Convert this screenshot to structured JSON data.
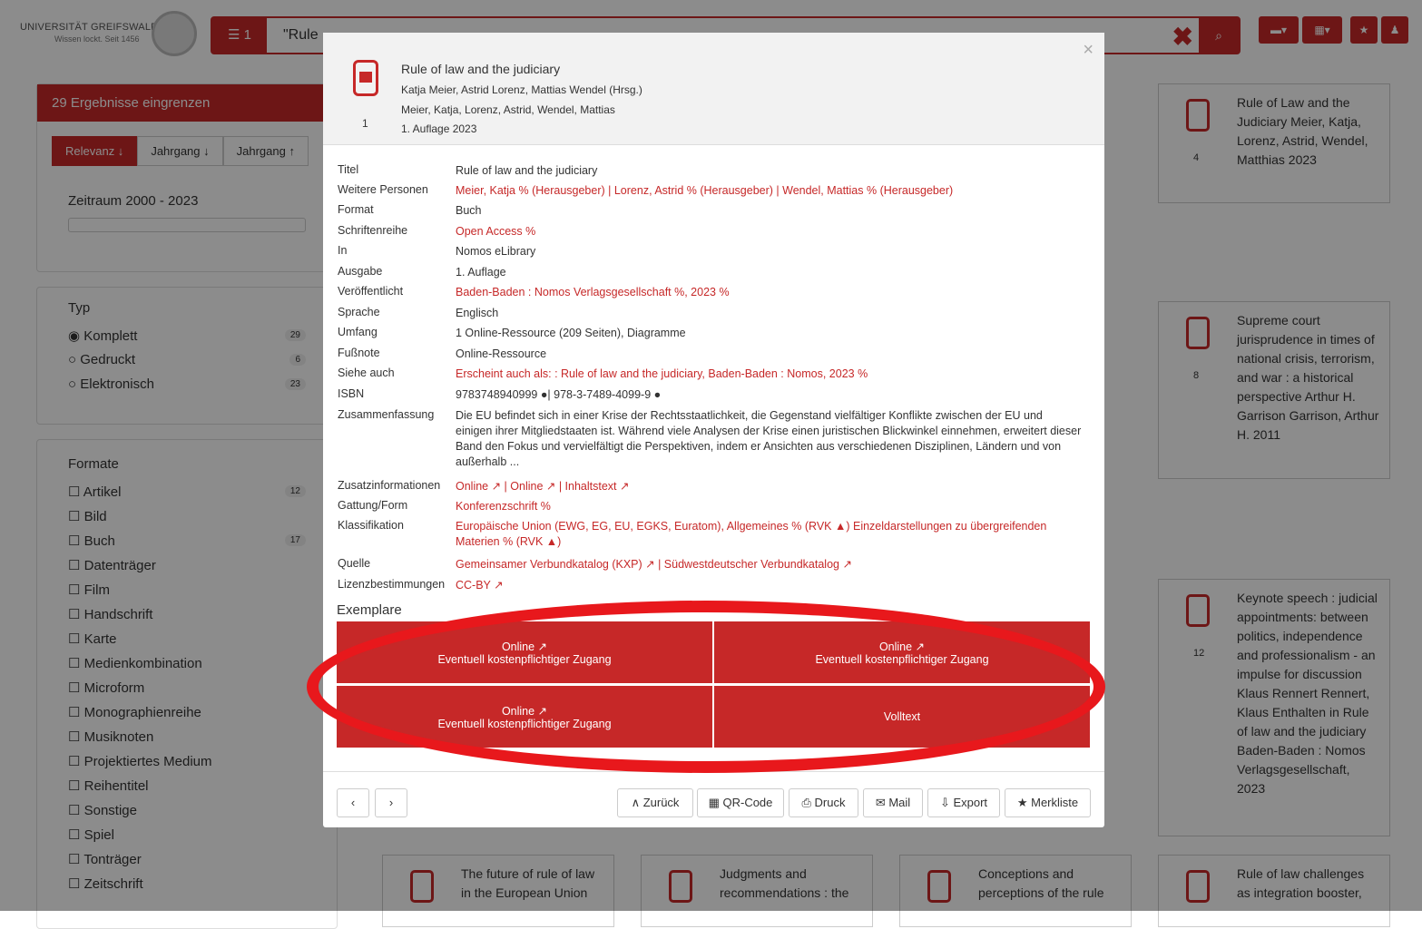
{
  "header": {
    "logo_line1": "UNIVERSITÄT GREIFSWALD",
    "logo_line2": "Wissen lockt. Seit 1456",
    "filter_count": "☰ 1",
    "query": "\"Rule",
    "clear": "✖",
    "search_icon": "⌕"
  },
  "sidebar": {
    "title": "29 Ergebnisse eingrenzen",
    "sort": [
      "Relevanz ↓",
      "Jahrgang ↓",
      "Jahrgang ↑"
    ],
    "zeitraum": "Zeitraum 2000 - 2023",
    "typ_title": "Typ",
    "typ": [
      {
        "label": "◉ Komplett",
        "count": "29"
      },
      {
        "label": "○ Gedruckt",
        "count": "6"
      },
      {
        "label": "○ Elektronisch",
        "count": "23"
      }
    ],
    "formate_title": "Formate",
    "formate": [
      {
        "label": "☐ Artikel",
        "count": "12"
      },
      {
        "label": "☐ Bild",
        "count": ""
      },
      {
        "label": "☐ Buch",
        "count": "17"
      },
      {
        "label": "☐ Datenträger",
        "count": ""
      },
      {
        "label": "☐ Film",
        "count": ""
      },
      {
        "label": "☐ Handschrift",
        "count": ""
      },
      {
        "label": "☐ Karte",
        "count": ""
      },
      {
        "label": "☐ Medienkombination",
        "count": ""
      },
      {
        "label": "☐ Microform",
        "count": ""
      },
      {
        "label": "☐ Monographienreihe",
        "count": ""
      },
      {
        "label": "☐ Musiknoten",
        "count": ""
      },
      {
        "label": "☐ Projektiertes Medium",
        "count": ""
      },
      {
        "label": "☐ Reihentitel",
        "count": ""
      },
      {
        "label": "☐ Sonstige",
        "count": ""
      },
      {
        "label": "☐ Spiel",
        "count": ""
      },
      {
        "label": "☐ Tonträger",
        "count": ""
      },
      {
        "label": "☐ Zeitschrift",
        "count": ""
      }
    ]
  },
  "results": [
    {
      "num": "4",
      "text": "Rule of Law and the Judiciary Meier, Katja, Lorenz, Astrid, Wendel, Matthias 2023"
    },
    {
      "num": "8",
      "text": "Supreme court jurisprudence in times of national crisis, terrorism, and war : a historical perspective Arthur H. Garrison Garrison, Arthur H. 2011"
    },
    {
      "num": "12",
      "text": "Keynote speech : judicial appointments: between politics, independence and professionalism - an impulse for discussion Klaus Rennert Rennert, Klaus Enthalten in Rule of law and the judiciary Baden-Baden : Nomos Verlagsgesellschaft, 2023"
    },
    {
      "num": "",
      "text": "Rule of law challenges as integration booster,"
    },
    {
      "num": "",
      "text": "The future of rule of law in the European Union"
    },
    {
      "num": "",
      "text": "Judgments and recommendations : the"
    },
    {
      "num": "",
      "text": "Conceptions and perceptions of the rule"
    }
  ],
  "modal": {
    "title": "Rule of law and the judiciary",
    "line1": "Katja Meier, Astrid Lorenz, Mattias Wendel (Hrsg.)",
    "line2": "Meier, Katja, Lorenz, Astrid, Wendel, Mattias",
    "line3": "1. Auflage 2023",
    "num": "1",
    "close": "×",
    "fields": [
      {
        "k": "Titel",
        "v": "Rule of law and the judiciary"
      },
      {
        "k": "Weitere Personen",
        "v": "Meier, Katja % (Herausgeber) | Lorenz, Astrid % (Herausgeber) | Wendel, Mattias % (Herausgeber)"
      },
      {
        "k": "Format",
        "v": "Buch"
      },
      {
        "k": "Schriftenreihe",
        "v": "Open Access %"
      },
      {
        "k": "In",
        "v": "Nomos eLibrary"
      },
      {
        "k": "Ausgabe",
        "v": "1. Auflage"
      },
      {
        "k": "Veröffentlicht",
        "v": "Baden-Baden : Nomos Verlagsgesellschaft %, 2023 %"
      },
      {
        "k": "Sprache",
        "v": "Englisch"
      },
      {
        "k": "Umfang",
        "v": "1 Online-Ressource (209 Seiten), Diagramme"
      },
      {
        "k": "Fußnote",
        "v": "Online-Ressource"
      },
      {
        "k": "Siehe auch",
        "v": "Erscheint auch als: : Rule of law and the judiciary, Baden-Baden : Nomos, 2023 %"
      },
      {
        "k": "ISBN",
        "v": "9783748940999 ●| 978-3-7489-4099-9 ●"
      },
      {
        "k": "Zusammenfassung",
        "v": "Die EU befindet sich in einer Krise der Rechtsstaatlichkeit, die Gegenstand vielfältiger Konflikte zwischen der EU und einigen ihrer Mitgliedstaaten ist. Während viele Analysen der Krise einen juristischen Blickwinkel einnehmen, erweitert dieser Band den Fokus und vervielfältigt die Perspektiven, indem er Ansichten aus verschiedenen Disziplinen, Ländern und von außerhalb ..."
      },
      {
        "k": "Zusatzinformationen",
        "v": "Online ↗ | Online ↗ | Inhaltstext ↗"
      },
      {
        "k": "Gattung/Form",
        "v": "Konferenzschrift %"
      },
      {
        "k": "Klassifikation",
        "v": "Europäische Union (EWG, EG, EU, EGKS, Euratom), Allgemeines % (RVK ▲) Einzeldarstellungen zu übergreifenden Materien % (RVK ▲)"
      },
      {
        "k": "Quelle",
        "v": "Gemeinsamer Verbundkatalog (KXP) ↗ | Südwestdeutscher Verbundkatalog ↗"
      },
      {
        "k": "Lizenzbestimmungen",
        "v": "CC-BY ↗"
      }
    ],
    "exemplare_title": "Exemplare",
    "exemplare": [
      {
        "a": "Online ↗",
        "b": "Eventuell kostenpflichtiger Zugang"
      },
      {
        "a": "Online ↗",
        "b": "Eventuell kostenpflichtiger Zugang"
      },
      {
        "a": "Online ↗",
        "b": "Eventuell kostenpflichtiger Zugang"
      },
      {
        "a": "Volltext",
        "b": ""
      }
    ],
    "footer": {
      "prev": "‹",
      "next": "›",
      "back": "∧ Zurück",
      "qr": "▦ QR-Code",
      "print": "⎙ Druck",
      "mail": "✉ Mail",
      "export": "⇩ Export",
      "fav": "★ Merkliste"
    }
  }
}
